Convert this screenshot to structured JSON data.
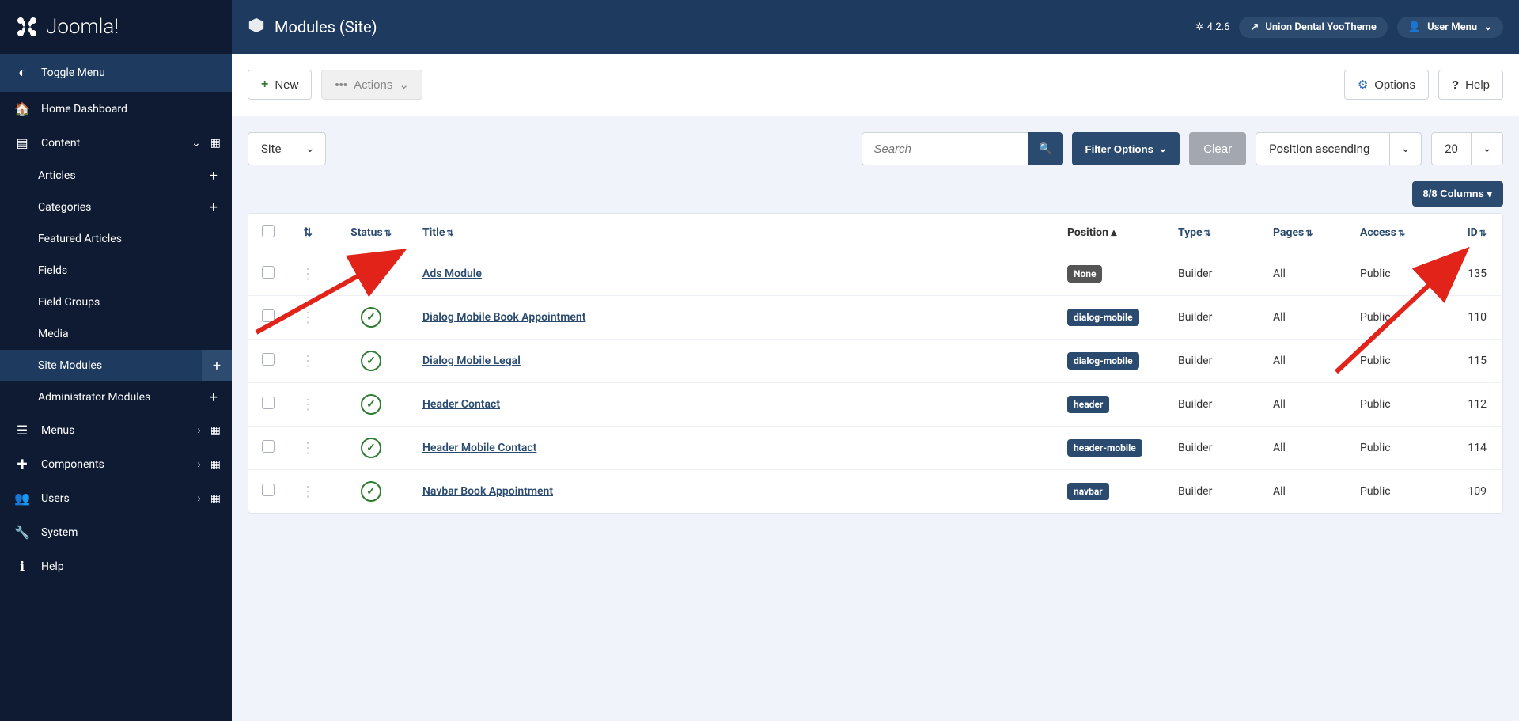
{
  "brand": "Joomla!",
  "header": {
    "title": "Modules (Site)",
    "version": "4.2.6",
    "site_name": "Union Dental YooTheme",
    "user_menu": "User Menu"
  },
  "sidebar": {
    "toggle": "Toggle Menu",
    "home": "Home Dashboard",
    "content": "Content",
    "content_sub": [
      "Articles",
      "Categories",
      "Featured Articles",
      "Fields",
      "Field Groups",
      "Media",
      "Site Modules",
      "Administrator Modules"
    ],
    "menus": "Menus",
    "components": "Components",
    "users": "Users",
    "system": "System",
    "help": "Help"
  },
  "toolbar": {
    "new": "New",
    "actions": "Actions",
    "options": "Options",
    "help": "Help"
  },
  "filters": {
    "client": "Site",
    "search_placeholder": "Search",
    "filter_options": "Filter Options",
    "clear": "Clear",
    "sort": "Position ascending",
    "limit": "20",
    "columns": "8/8 Columns"
  },
  "columns": {
    "status": "Status",
    "title": "Title",
    "position": "Position",
    "type": "Type",
    "pages": "Pages",
    "access": "Access",
    "id": "ID"
  },
  "rows": [
    {
      "title": "Ads Module",
      "position": "None",
      "pos_style": "none",
      "type": "Builder",
      "pages": "All",
      "access": "Public",
      "id": "135"
    },
    {
      "title": "Dialog Mobile Book Appointment",
      "position": "dialog-mobile",
      "pos_style": "",
      "type": "Builder",
      "pages": "All",
      "access": "Public",
      "id": "110"
    },
    {
      "title": "Dialog Mobile Legal",
      "position": "dialog-mobile",
      "pos_style": "",
      "type": "Builder",
      "pages": "All",
      "access": "Public",
      "id": "115"
    },
    {
      "title": "Header Contact",
      "position": "header",
      "pos_style": "",
      "type": "Builder",
      "pages": "All",
      "access": "Public",
      "id": "112"
    },
    {
      "title": "Header Mobile Contact",
      "position": "header-mobile",
      "pos_style": "",
      "type": "Builder",
      "pages": "All",
      "access": "Public",
      "id": "114"
    },
    {
      "title": "Navbar Book Appointment",
      "position": "navbar",
      "pos_style": "",
      "type": "Builder",
      "pages": "All",
      "access": "Public",
      "id": "109"
    }
  ]
}
